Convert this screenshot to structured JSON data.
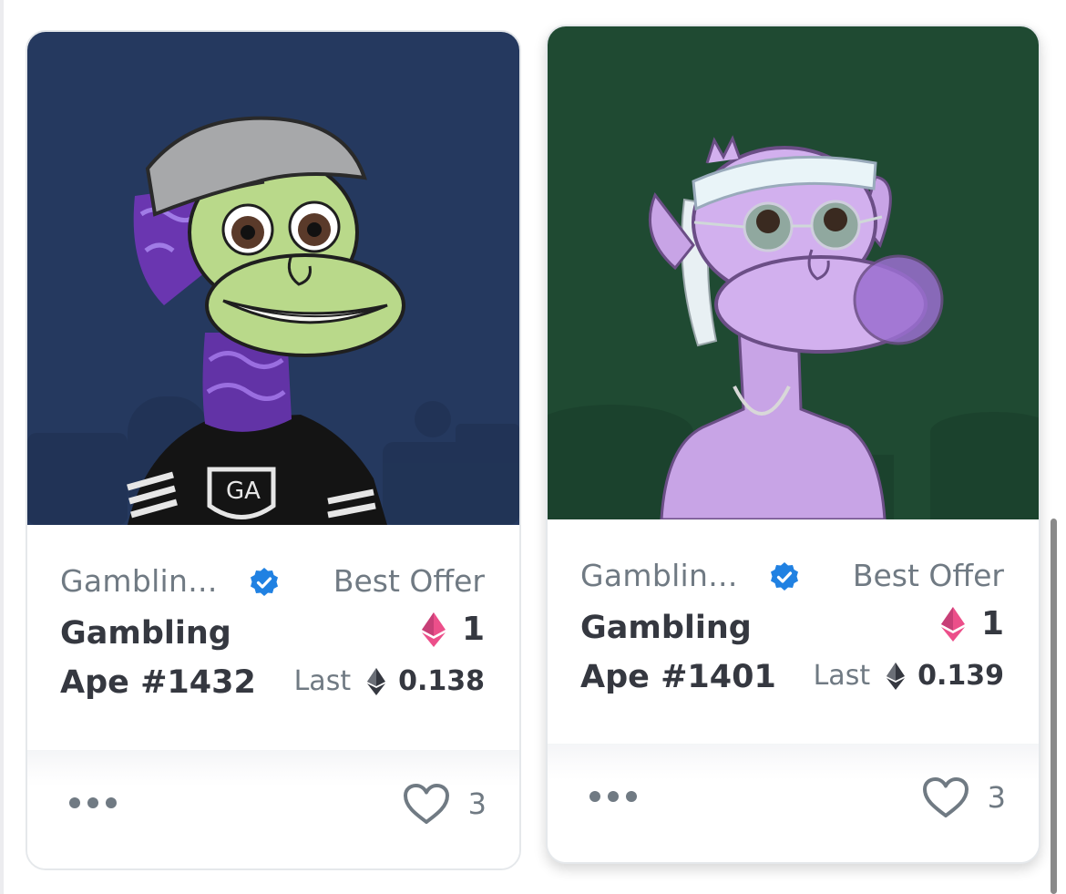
{
  "cards": [
    {
      "collection": "Gamblin...",
      "name": "Gambling Ape #1432",
      "best_offer_label": "Best Offer",
      "best_offer_value": "1",
      "last_label": "Last",
      "last_value": "0.138",
      "likes": "3",
      "background_color": "#25395f"
    },
    {
      "collection": "Gamblin...",
      "name": "Gambling Ape #1401",
      "best_offer_label": "Best Offer",
      "best_offer_value": "1",
      "last_label": "Last",
      "last_value": "0.139",
      "likes": "3",
      "background_color": "#1f4a32"
    }
  ],
  "colors": {
    "verified": "#2081e2",
    "weth": "#ec4f8a",
    "text_primary": "#353840",
    "text_secondary": "#707a83"
  },
  "icons": [
    "verified-badge-icon",
    "weth-icon",
    "eth-icon",
    "more-options-icon",
    "heart-icon"
  ]
}
